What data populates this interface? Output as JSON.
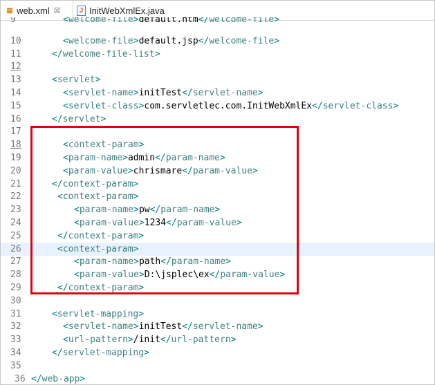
{
  "tabs": [
    {
      "label": "web.xml",
      "icon": "rss-xml-icon",
      "close": "☒"
    },
    {
      "label": "InitWebXmlEx.java",
      "icon": "java-file-icon"
    }
  ],
  "lines": [
    {
      "n": "9",
      "indent": 2,
      "tag": "welcome-file",
      "text": "default.htm",
      "clipped": true
    },
    {
      "n": "10",
      "indent": 2,
      "tag": "welcome-file",
      "text": "default.jsp"
    },
    {
      "n": "11",
      "indent": 1,
      "close": "welcome-file-list"
    },
    {
      "n": "12",
      "indent": 0,
      "underline": true
    },
    {
      "n": "13",
      "indent": 1,
      "open": "servlet"
    },
    {
      "n": "14",
      "indent": 2,
      "tag": "servlet-name",
      "text": "initTest"
    },
    {
      "n": "15",
      "indent": 2,
      "tag": "servlet-class",
      "text": "com.servletlec.com.InitWebXmlEx"
    },
    {
      "n": "16",
      "indent": 1,
      "close": "servlet"
    },
    {
      "n": "17",
      "indent": 0
    },
    {
      "n": "18",
      "indent": 2,
      "open": "context-param",
      "underline": true
    },
    {
      "n": "19",
      "indent": 2,
      "tag": "param-name",
      "text": "admin"
    },
    {
      "n": "20",
      "indent": 2,
      "tag": "param-value",
      "text": "chrismare"
    },
    {
      "n": "21",
      "indent": 1,
      "close": "context-param"
    },
    {
      "n": "22",
      "indent": 1.5,
      "open": "context-param"
    },
    {
      "n": "23",
      "indent": 3,
      "tag": "param-name",
      "text": "pw"
    },
    {
      "n": "24",
      "indent": 3,
      "tag": "param-value",
      "text": "1234"
    },
    {
      "n": "25",
      "indent": 1.5,
      "close": "context-param"
    },
    {
      "n": "26",
      "indent": 1.5,
      "open": "context-param",
      "highlight": true
    },
    {
      "n": "27",
      "indent": 3,
      "tag": "param-name",
      "text": "path"
    },
    {
      "n": "28",
      "indent": 3,
      "tag": "param-value",
      "text": "D:\\jsplec\\ex"
    },
    {
      "n": "29",
      "indent": 1.5,
      "close": "context-param"
    },
    {
      "n": "30",
      "indent": 0
    },
    {
      "n": "31",
      "indent": 1,
      "open": "servlet-mapping"
    },
    {
      "n": "32",
      "indent": 2,
      "tag": "servlet-name",
      "text": "initTest"
    },
    {
      "n": "33",
      "indent": 2,
      "tag": "url-pattern",
      "text": "/init"
    },
    {
      "n": "34",
      "indent": 1,
      "close": "servlet-mapping"
    },
    {
      "n": "35",
      "indent": 0
    },
    {
      "n": "36",
      "indent": 0,
      "close": "web-app"
    }
  ],
  "colors": {
    "tag": "#3f7f7f",
    "bracket": "#008080",
    "text": "#000000",
    "annotation": "#e3000f",
    "current_line": "#e8f2fe"
  }
}
